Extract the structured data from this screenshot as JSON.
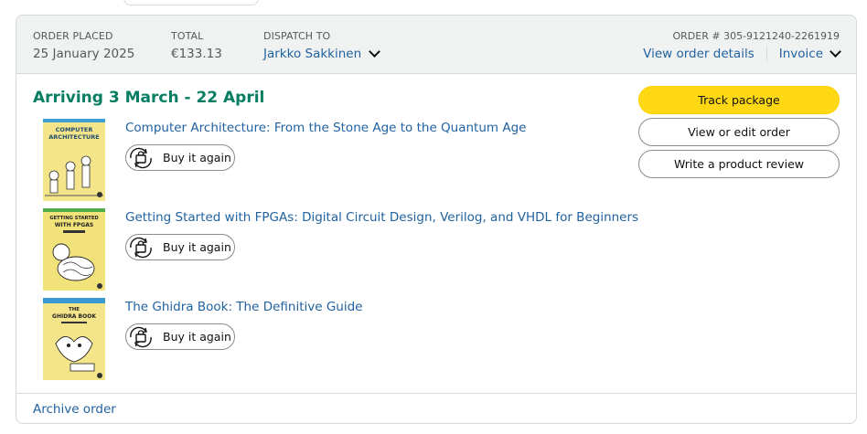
{
  "header": {
    "order_placed_label": "ORDER PLACED",
    "order_placed_value": "25 January 2025",
    "total_label": "TOTAL",
    "total_value": "€133.13",
    "dispatch_label": "DISPATCH TO",
    "dispatch_value": "Jarkko Sakkinen",
    "order_number": "ORDER # 305-9121240-2261919",
    "view_details": "View order details",
    "invoice": "Invoice"
  },
  "delivery": {
    "status": "Arriving 3 March - 22 April"
  },
  "items": [
    {
      "title": "Computer Architecture: From the Stone Age to the Quantum Age",
      "buy_again": "Buy it again"
    },
    {
      "title": "Getting Started with FPGAs: Digital Circuit Design, Verilog, and VHDL for Beginners",
      "buy_again": "Buy it again"
    },
    {
      "title": "The Ghidra Book: The Definitive Guide",
      "buy_again": "Buy it again"
    }
  ],
  "covers": [
    {
      "line1": "COMPUTER",
      "line2": "ARCHITECTURE",
      "bg": "#f4e58a",
      "accent": "#2f6b8f"
    },
    {
      "line1": "GETTING STARTED",
      "line2": "WITH FPGAS",
      "bg": "#f2e27a",
      "accent": "#1f1f1f"
    },
    {
      "line1": "THE",
      "line2": "GHIDRA BOOK",
      "bg": "#f4e58a",
      "accent": "#3b9bd0"
    }
  ],
  "actions": {
    "track": "Track package",
    "view_edit": "View or edit order",
    "review": "Write a product review"
  },
  "footer": {
    "archive": "Archive order"
  },
  "colors": {
    "link": "#2162a1",
    "delivery_green": "#067d62",
    "primary_button": "#ffd814",
    "header_bg": "#f0f2f2"
  },
  "icons": {
    "buy_again": "cart-reorder-icon",
    "dropdown": "chevron-down-icon"
  }
}
